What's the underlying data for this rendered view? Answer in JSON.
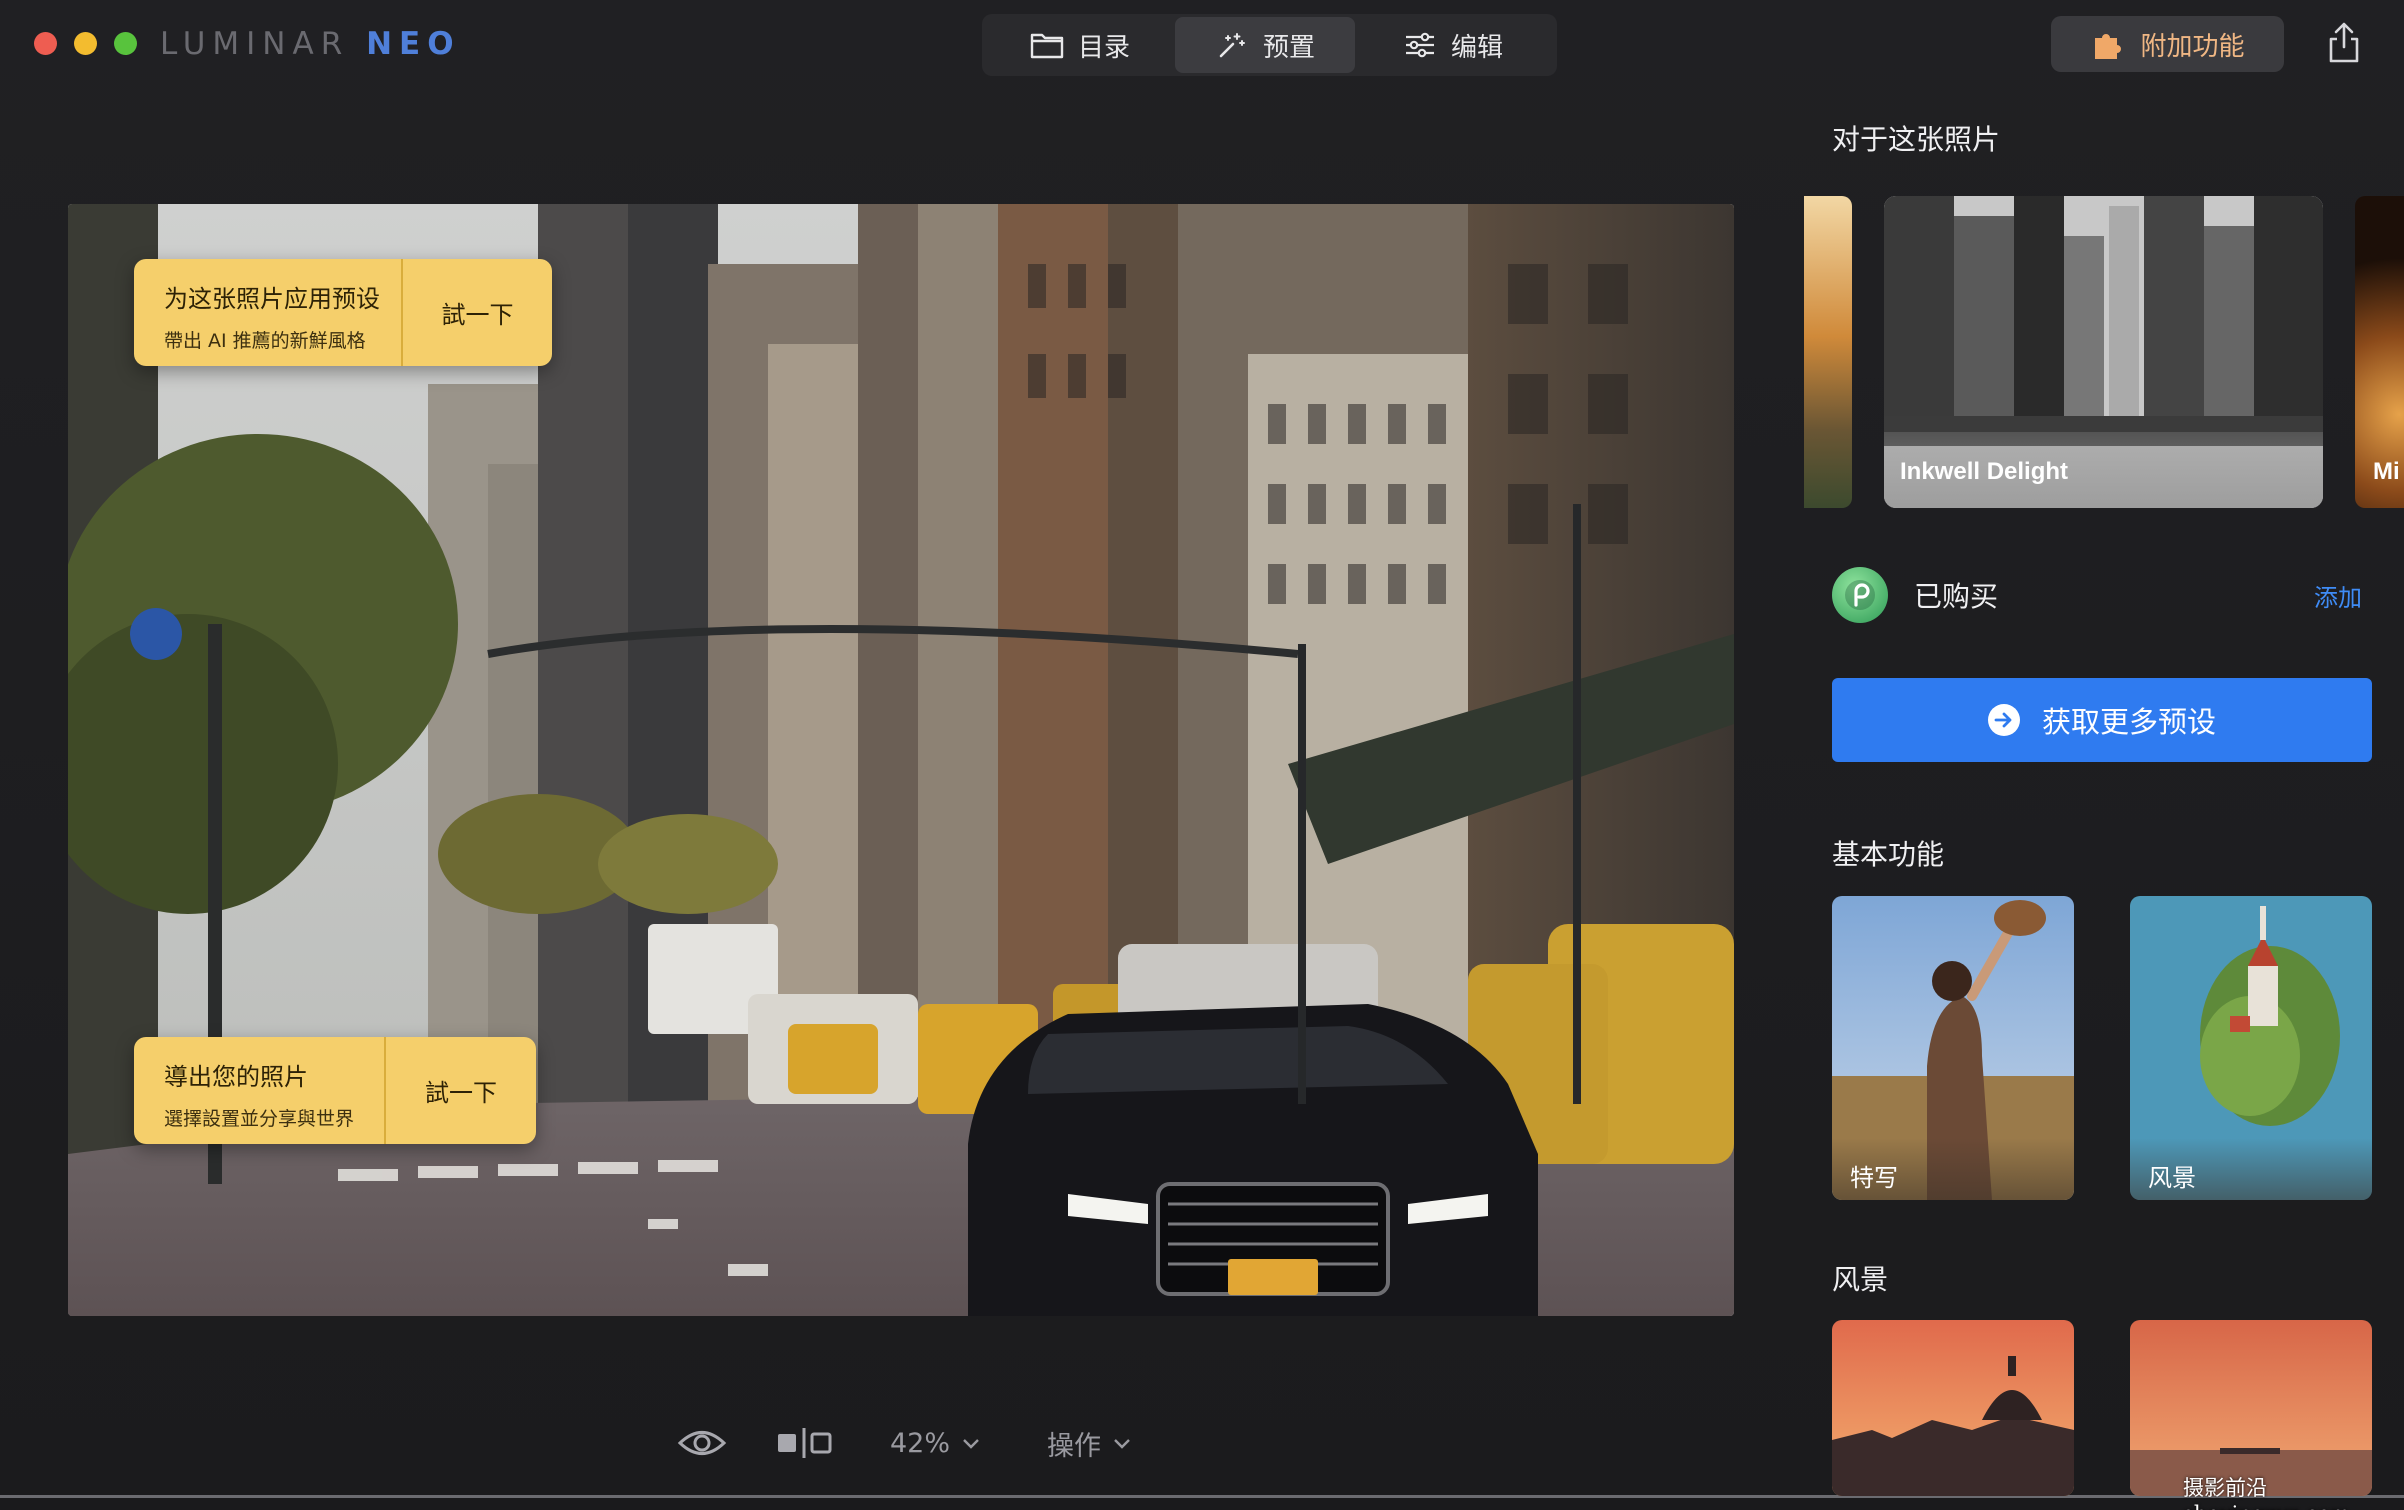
{
  "app": {
    "logo_part1": "LUMINAR",
    "logo_part2": "NEO",
    "colors": {
      "accent_blue": "#2f7bf0",
      "addon_text": "#f0b784",
      "tip_bg": "#f5cf6b",
      "link": "#3f8cf6"
    }
  },
  "nav": {
    "tabs": [
      {
        "label": "目录",
        "icon": "folder-icon",
        "active": false
      },
      {
        "label": "预置",
        "icon": "magic-wand-icon",
        "active": true
      },
      {
        "label": "编辑",
        "icon": "sliders-icon",
        "active": false
      }
    ],
    "addons_label": "附加功能",
    "addons_icon": "puzzle-icon",
    "share_icon": "share-icon"
  },
  "canvas": {
    "tip1": {
      "title": "为这张照片应用预设",
      "subtitle": "帶出 AI 推薦的新鮮風格",
      "button": "試一下"
    },
    "tip2": {
      "title": "導出您的照片",
      "subtitle": "選擇設置並分享與世界",
      "button": "試一下"
    }
  },
  "toolbar": {
    "eye_icon": "eye-icon",
    "compare_icon": "compare-icon",
    "zoom": "42%",
    "actions": "操作"
  },
  "panel": {
    "for_this_photo": "对于这张照片",
    "featured_preset": "Inkwell Delight",
    "next_preset_partial": "Mi",
    "purchased_label": "已购买",
    "add_label": "添加",
    "get_more_label": "获取更多预设",
    "basic_title": "基本功能",
    "basic_items": [
      {
        "label": "特写"
      },
      {
        "label": "风景"
      }
    ],
    "landscape_title": "风景"
  },
  "watermark": "摄影前沿 sheyingzyz.com"
}
